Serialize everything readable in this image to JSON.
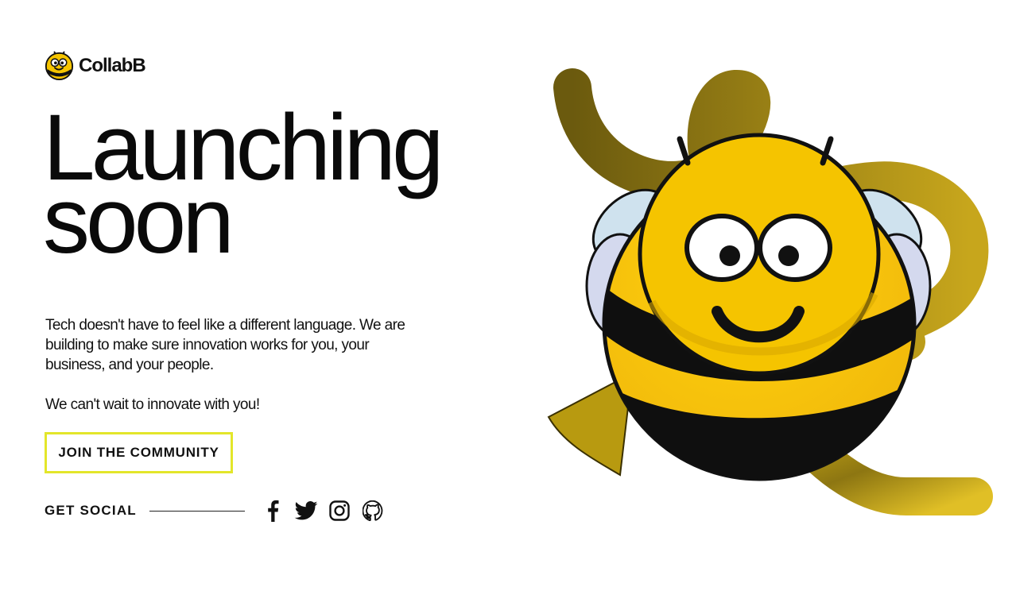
{
  "brand": {
    "name": "CollabB",
    "logo_icon": "bee-face-icon"
  },
  "hero": {
    "headline_line1": "Launching",
    "headline_line2": "soon",
    "paragraph1": "Tech doesn't have to feel like a different language. We are building to make sure innovation works for you, your business, and your people.",
    "paragraph2": "We can't wait to innovate with you!"
  },
  "cta": {
    "label": "JOIN THE COMMUNITY"
  },
  "social": {
    "label": "GET SOCIAL",
    "icons": [
      "facebook-icon",
      "twitter-icon",
      "instagram-icon",
      "github-icon"
    ]
  },
  "colors": {
    "accent_yellow": "#f5c400",
    "cta_border": "#e3e62a",
    "trail_olive": "#b59a12",
    "text": "#0c0c0c"
  }
}
